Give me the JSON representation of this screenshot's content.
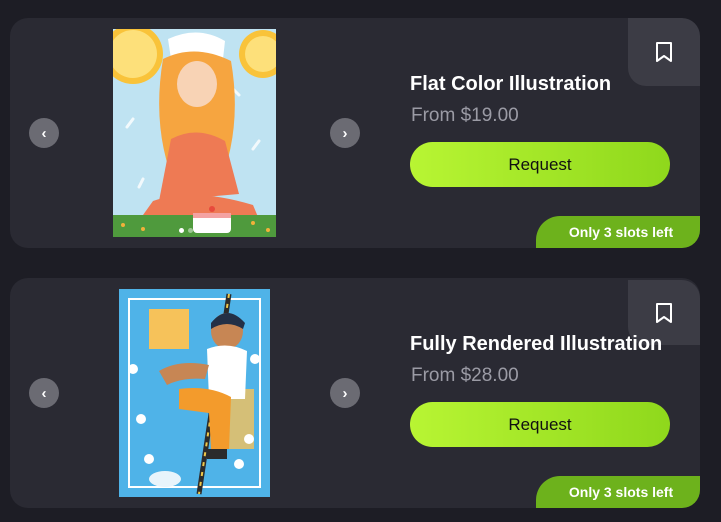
{
  "listings": [
    {
      "title": "Flat Color Illustration",
      "price": "From $19.00",
      "request_label": "Request",
      "slots_label": "Only 3 slots left",
      "prev_glyph": "‹",
      "next_glyph": "›",
      "image_count": 4,
      "active_image": 1
    },
    {
      "title": "Fully Rendered Illustration",
      "price": "From $28.00",
      "request_label": "Request",
      "slots_label": "Only 3 slots left",
      "prev_glyph": "‹",
      "next_glyph": "›"
    }
  ],
  "icons": {
    "bookmark": "bookmark-icon",
    "prev": "chevron-left-icon",
    "next": "chevron-right-icon"
  },
  "colors": {
    "page_background": "#1d1d25",
    "card_background": "#2a2a33",
    "accent_green": "#9be01f",
    "badge_green": "#6db21c",
    "price_text": "#9b9ba5"
  }
}
